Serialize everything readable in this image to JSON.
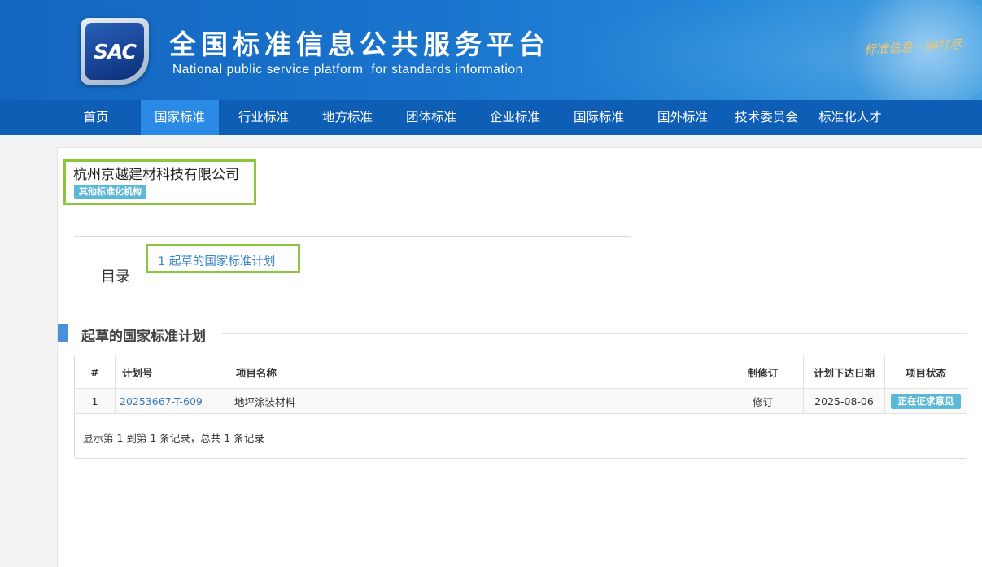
{
  "header": {
    "logo_text": "SAC",
    "title_cn": "全国标准信息公共服务平台",
    "title_en": "National public service platform  for standards information",
    "slogan": "标准信息一网打尽"
  },
  "nav": {
    "items": [
      {
        "label": "首页",
        "active": false
      },
      {
        "label": "国家标准",
        "active": true
      },
      {
        "label": "行业标准",
        "active": false
      },
      {
        "label": "地方标准",
        "active": false
      },
      {
        "label": "团体标准",
        "active": false
      },
      {
        "label": "企业标准",
        "active": false
      },
      {
        "label": "国际标准",
        "active": false
      },
      {
        "label": "国外标准",
        "active": false
      },
      {
        "label": "技术委员会",
        "active": false
      },
      {
        "label": "标准化人才",
        "active": false
      }
    ]
  },
  "org": {
    "name": "杭州京越建材科技有限公司",
    "tag": "其他标准化机构"
  },
  "toc": {
    "label": "目录",
    "items": [
      {
        "label": "1  起草的国家标准计划"
      }
    ]
  },
  "section": {
    "title": "起草的国家标准计划",
    "table": {
      "headers": [
        "#",
        "计划号",
        "项目名称",
        "制修订",
        "计划下达日期",
        "项目状态"
      ],
      "rows": [
        {
          "index": "1",
          "plan_no": "20253667-T-609",
          "name": "地坪涂装材料",
          "type": "修订",
          "date": "2025-08-06",
          "status": "正在征求意见"
        }
      ],
      "footer": "显示第 1 到第 1 条记录，总共 1 条记录"
    }
  },
  "colors": {
    "nav_bg": "#0f5eb5",
    "nav_active": "#2a8ae6",
    "highlight_box": "#8cc63e",
    "tag_bg": "#5bb8d6",
    "link": "#3a78b8"
  }
}
